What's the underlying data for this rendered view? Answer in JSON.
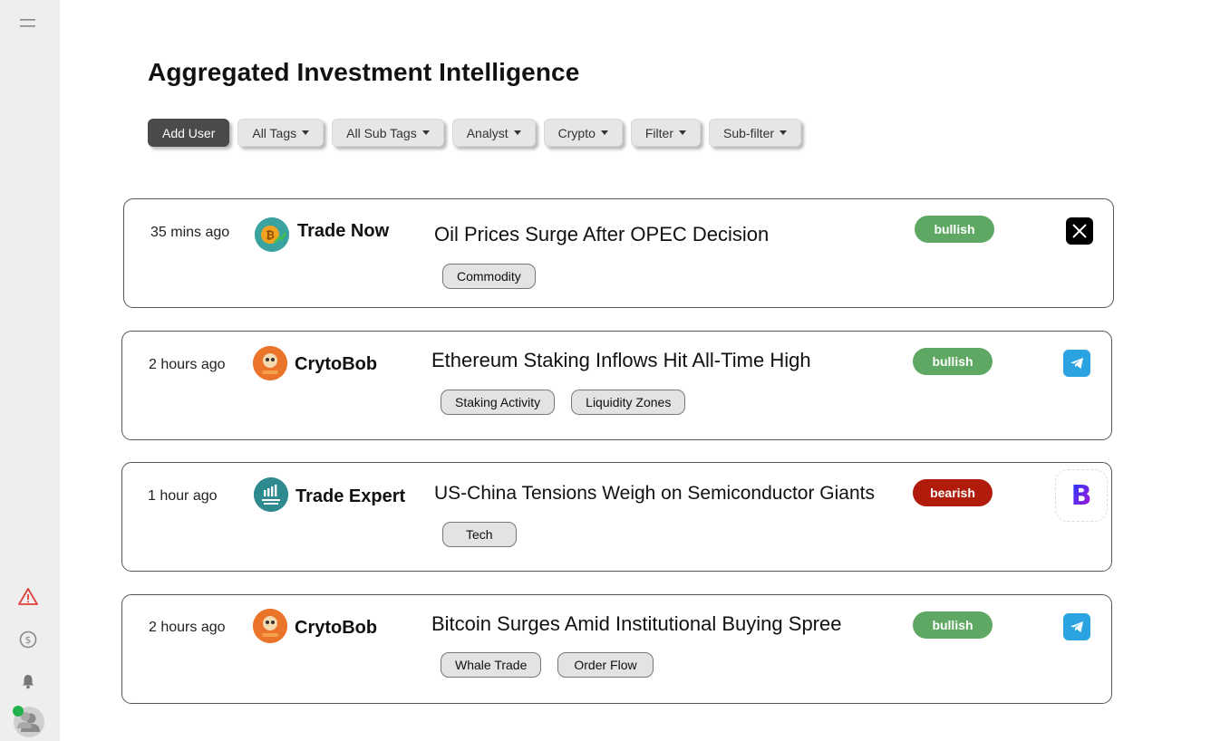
{
  "page": {
    "title": "Aggregated Investment Intelligence"
  },
  "toolbar": {
    "add_user": "Add User",
    "dropdowns": [
      "All Tags",
      "All Sub Tags",
      "Analyst",
      "Crypto",
      "Filter",
      "Sub-filter"
    ]
  },
  "sidebar": {
    "icons": [
      "menu-icon",
      "alert-icon",
      "dollar-circle-icon",
      "bell-icon",
      "user-avatar"
    ]
  },
  "colors": {
    "bullish": "#5fa864",
    "bearish": "#b01b0b",
    "primary_button": "#4a4a4a",
    "online": "#22b14c"
  },
  "posts": [
    {
      "time": "35 mins ago",
      "author": "Trade Now",
      "avatar_icon": "bitcoin-growth-logo",
      "headline": "Oil Prices Surge After OPEC Decision",
      "tags": [
        "Commodity"
      ],
      "sentiment": "bullish",
      "source": "x-icon"
    },
    {
      "time": "2 hours ago",
      "author": "CrytoBob",
      "avatar_icon": "cryptobob-logo",
      "headline": "Ethereum Staking Inflows Hit All-Time High",
      "tags": [
        "Staking Activity",
        "Liquidity Zones"
      ],
      "sentiment": "bullish",
      "source": "telegram-icon"
    },
    {
      "time": "1 hour ago",
      "author": "Trade Expert",
      "avatar_icon": "trade-expert-logo",
      "headline": "US-China Tensions Weigh on Semiconductor Giants",
      "tags": [
        "Tech"
      ],
      "sentiment": "bearish",
      "source": "b-brand-icon"
    },
    {
      "time": "2 hours ago",
      "author": "CrytoBob",
      "avatar_icon": "cryptobob-logo",
      "headline": "Bitcoin Surges Amid Institutional Buying Spree",
      "tags": [
        "Whale Trade",
        "Order Flow"
      ],
      "sentiment": "bullish",
      "source": "telegram-icon"
    }
  ]
}
